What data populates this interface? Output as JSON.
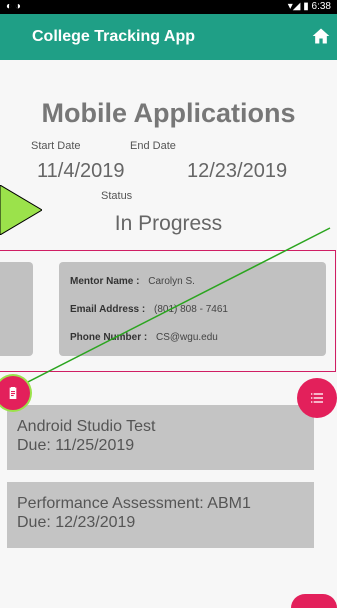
{
  "statusbar": {
    "left": "◐ ◑",
    "right": "▾◢ ▮ 6:38"
  },
  "appbar": {
    "title": "College Tracking App"
  },
  "course": {
    "title": "Mobile Applications",
    "start_label": "Start Date",
    "end_label": "End Date",
    "start_date": "11/4/2019",
    "end_date": "12/23/2019",
    "status_label": "Status",
    "status": "In Progress"
  },
  "mentor": {
    "name_label": "Mentor Name :",
    "name": "Carolyn S.",
    "email_label": "Email Address :",
    "email": "(801) 808 - 7461",
    "phone_label": "Phone Number :",
    "phone": "CS@wgu.edu"
  },
  "assessments": [
    {
      "name": "Android Studio Test",
      "due": "Due: 11/25/2019"
    },
    {
      "name": "Performance Assessment: ABM1",
      "due": "Due: 12/23/2019"
    }
  ],
  "colors": {
    "appbar": "#1f9f86",
    "accent": "#e3205b",
    "card": "#c1c1c1",
    "annotation": "#2ba51f"
  },
  "icons": {
    "home": "home-icon",
    "clipboard": "clipboard-icon",
    "list": "list-icon"
  }
}
